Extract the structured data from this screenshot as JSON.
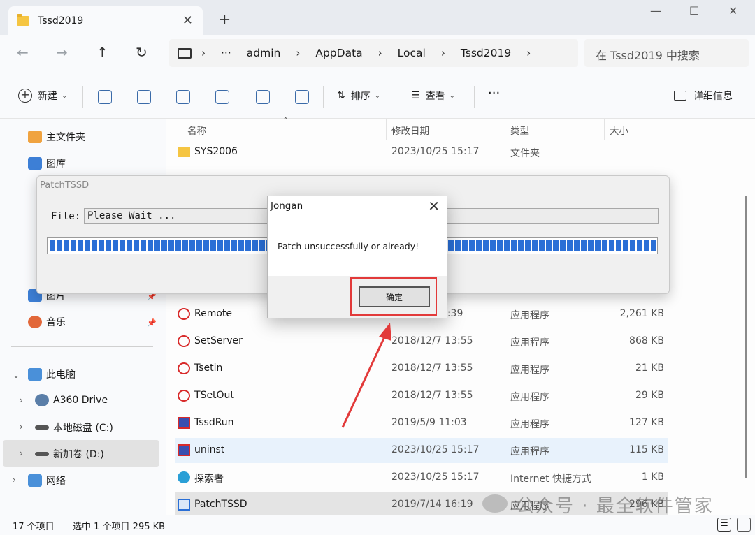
{
  "tab": {
    "title": "Tssd2019",
    "close": "✕",
    "newtab": "+"
  },
  "window": {
    "minimize": "—",
    "maximize": "☐",
    "close": "✕"
  },
  "nav": {
    "back": "←",
    "forward": "→",
    "up": "↑",
    "refresh": "↻"
  },
  "address": {
    "more": "···",
    "crumbs": [
      "admin",
      "AppData",
      "Local",
      "Tssd2019"
    ],
    "sep": "›"
  },
  "search": {
    "placeholder": "在 Tssd2019 中搜索"
  },
  "toolbar": {
    "new_label": "新建",
    "sort_label": "排序",
    "view_label": "查看",
    "more": "···",
    "details_label": "详细信息"
  },
  "sidebar": {
    "home": "主文件夹",
    "gallery": "图库",
    "pictures": "图片",
    "music": "音乐",
    "thispc": "此电脑",
    "a360": "A360 Drive",
    "cdrive": "本地磁盘 (C:)",
    "ddrive": "新加卷 (D:)",
    "network": "网络"
  },
  "columns": {
    "name": "名称",
    "date": "修改日期",
    "type": "类型",
    "size": "大小"
  },
  "rows": [
    {
      "name": "SYS2006",
      "date": "2023/10/25 15:17",
      "type": "文件夹",
      "size": ""
    },
    {
      "name": "Remote",
      "date": "16:39",
      "type": "应用程序",
      "size": "2,261 KB"
    },
    {
      "name": "SetServer",
      "date": "2018/12/7 13:55",
      "type": "应用程序",
      "size": "868 KB"
    },
    {
      "name": "Tsetin",
      "date": "2018/12/7 13:55",
      "type": "应用程序",
      "size": "21 KB"
    },
    {
      "name": "TSetOut",
      "date": "2018/12/7 13:55",
      "type": "应用程序",
      "size": "29 KB"
    },
    {
      "name": "TssdRun",
      "date": "2019/5/9 11:03",
      "type": "应用程序",
      "size": "127 KB"
    },
    {
      "name": "uninst",
      "date": "2023/10/25 15:17",
      "type": "应用程序",
      "size": "115 KB"
    },
    {
      "name": "探索者",
      "date": "2023/10/25 15:17",
      "type": "Internet 快捷方式",
      "size": "1 KB"
    },
    {
      "name": "PatchTSSD",
      "date": "2019/7/14 16:19",
      "type": "应用程序",
      "size": "296 KB"
    }
  ],
  "status": {
    "count": "17 个项目",
    "selected": "选中 1 个项目  295 KB"
  },
  "patch": {
    "title": "PatchTSSD",
    "file_label": "File:",
    "file_value": "Please Wait ...",
    "progress_pct": 100
  },
  "jongan": {
    "title": "Jongan",
    "close": "✕",
    "message": "Patch unsuccessfully or already!",
    "ok_label": "确定"
  },
  "watermark": {
    "text": "公众号 · 最全软件管家"
  },
  "colors": {
    "accent": "#2a6fd6",
    "highlight": "#e23a3a"
  }
}
